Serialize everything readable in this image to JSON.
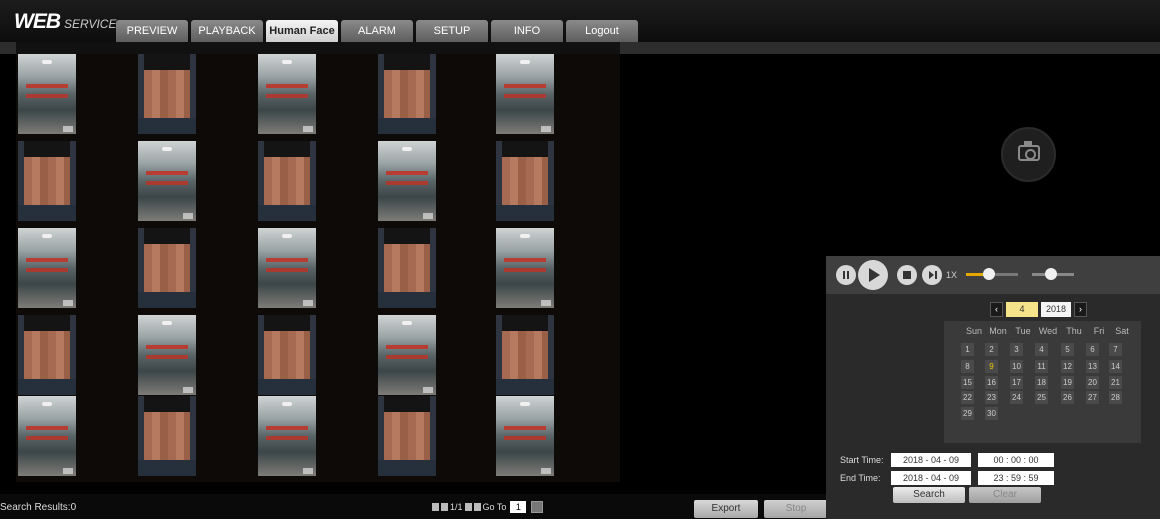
{
  "header": {
    "logo_web": "WEB",
    "logo_service": "SERVICE",
    "tabs": [
      {
        "label": "PREVIEW"
      },
      {
        "label": "PLAYBACK"
      },
      {
        "label": "Human Face"
      },
      {
        "label": "ALARM"
      },
      {
        "label": "SETUP"
      },
      {
        "label": "INFO"
      },
      {
        "label": "Logout"
      }
    ],
    "active_tab": "Human Face"
  },
  "gallery": {
    "search_results": "Search Results:0",
    "pager_text": "1/1",
    "goto_label": "Go To",
    "goto_value": "1",
    "export_label": "Export",
    "stop_label": "Stop"
  },
  "playback": {
    "speed_label": "1X",
    "speed_level": 0.45,
    "volume_level": 0.45
  },
  "calendar": {
    "month": "4",
    "year": "2018",
    "weekdays": [
      "Sun",
      "Mon",
      "Tue",
      "Wed",
      "Thu",
      "Fri",
      "Sat"
    ],
    "days": [
      "1",
      "2",
      "3",
      "4",
      "5",
      "6",
      "7",
      "8",
      "9",
      "10",
      "11",
      "12",
      "13",
      "14",
      "15",
      "16",
      "17",
      "18",
      "19",
      "20",
      "21",
      "22",
      "23",
      "24",
      "25",
      "26",
      "27",
      "28",
      "29",
      "30"
    ],
    "selected_day": "9"
  },
  "search_form": {
    "start_label": "Start Time:",
    "end_label": "End Time:",
    "start_date": "2018 - 04 - 09",
    "start_time": "00 : 00 : 00",
    "end_date": "2018 - 04 - 09",
    "end_time": "23 : 59 : 59",
    "search_label": "Search",
    "clear_label": "Clear"
  },
  "colors": {
    "accent": "#e4a800",
    "selected_day": "#f5c400",
    "background": "#000000"
  }
}
